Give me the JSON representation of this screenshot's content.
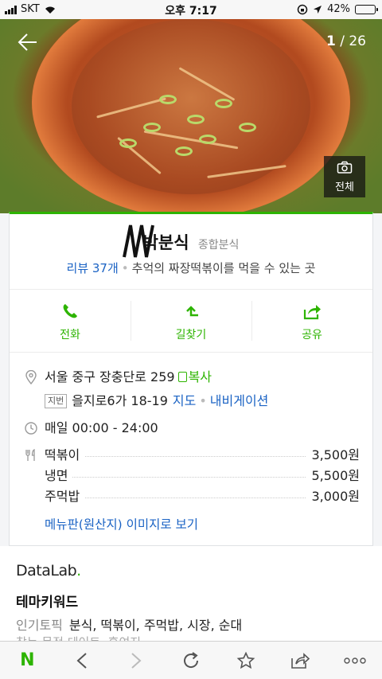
{
  "status": {
    "carrier": "SKT",
    "time": "오후 7:17",
    "battery": "42%",
    "battery_level": 0.42
  },
  "gallery": {
    "current": "1",
    "total": "/ 26",
    "all_label": "전체"
  },
  "place": {
    "name": "박분식",
    "category": "종합분식",
    "reviews": "리뷰 37개",
    "description": "추억의 짜장떡볶이를 먹을 수 있는 곳"
  },
  "actions": {
    "call": "전화",
    "directions": "길찾기",
    "share": "공유"
  },
  "info": {
    "address": "서울 중구 장충단로 259",
    "copy": "복사",
    "jibun_tag": "지번",
    "jibun_address": "을지로6가 18-19",
    "map_link": "지도",
    "nav_link": "내비게이션",
    "hours": "매일 00:00 - 24:00",
    "menu": [
      {
        "name": "떡볶이",
        "price": "3,500원"
      },
      {
        "name": "냉면",
        "price": "5,500원"
      },
      {
        "name": "주먹밥",
        "price": "3,000원"
      }
    ],
    "menu_link": "메뉴판(원산지) 이미지로 보기"
  },
  "datalab": {
    "brand": "DataLab",
    "dot": ".",
    "theme_title": "테마키워드",
    "topic_label": "인기토픽",
    "topic_values": "분식, 떡볶이, 주먹밥, 시장, 순대",
    "topic2_partial": "찾는 목적  데이트, 혼여지"
  },
  "colors": {
    "accent": "#2db400",
    "link": "#1b63c4"
  }
}
